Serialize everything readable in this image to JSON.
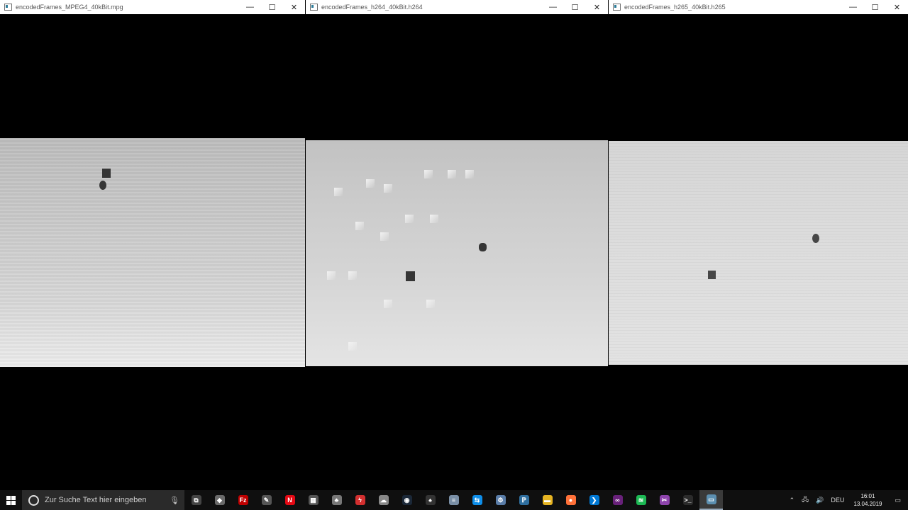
{
  "windows": [
    {
      "title": "encodedFrames_MPEG4_40kBit.mpg"
    },
    {
      "title": "encodedFrames_h264_40kBit.h264"
    },
    {
      "title": "encodedFrames_h265_40kBit.h265"
    }
  ],
  "window_controls": {
    "minimize": "—",
    "maximize": "☐",
    "close": "✕"
  },
  "taskbar": {
    "search_placeholder": "Zur Suche Text hier eingeben",
    "language": "DEU",
    "time": "16:01",
    "date": "13.04.2019",
    "apps": [
      {
        "icon": "task-view-icon",
        "glyph": "⧉",
        "color": "#444444"
      },
      {
        "icon": "git-icon",
        "glyph": "◆",
        "color": "#6a6a6a"
      },
      {
        "icon": "filezilla-icon",
        "glyph": "Fz",
        "color": "#bf0000"
      },
      {
        "icon": "inkscape-icon",
        "glyph": "✎",
        "color": "#555555"
      },
      {
        "icon": "netflix-icon",
        "glyph": "N",
        "color": "#e50914"
      },
      {
        "icon": "calculator-icon",
        "glyph": "▦",
        "color": "#555555"
      },
      {
        "icon": "bird-app-icon",
        "glyph": "♣",
        "color": "#777777"
      },
      {
        "icon": "flash-icon",
        "glyph": "ϟ",
        "color": "#d32f2f"
      },
      {
        "icon": "cloud-app-icon",
        "glyph": "☁",
        "color": "#888888"
      },
      {
        "icon": "steam-icon",
        "glyph": "◉",
        "color": "#1b2838"
      },
      {
        "icon": "cards-icon",
        "glyph": "♠",
        "color": "#333333"
      },
      {
        "icon": "notepad-icon",
        "glyph": "≡",
        "color": "#7a8fa6"
      },
      {
        "icon": "teamviewer-icon",
        "glyph": "⇆",
        "color": "#0e8ee9"
      },
      {
        "icon": "network-app-icon",
        "glyph": "⚙",
        "color": "#5a7da8"
      },
      {
        "icon": "python-icon",
        "glyph": "ℙ",
        "color": "#2f6f9f"
      },
      {
        "icon": "file-explorer-icon",
        "glyph": "▬",
        "color": "#e6b422"
      },
      {
        "icon": "firefox-icon",
        "glyph": "●",
        "color": "#ff7139"
      },
      {
        "icon": "vscode-icon",
        "glyph": "❯",
        "color": "#0078d4"
      },
      {
        "icon": "visual-studio-icon",
        "glyph": "∞",
        "color": "#68217a"
      },
      {
        "icon": "spotify-icon",
        "glyph": "≋",
        "color": "#1db954"
      },
      {
        "icon": "snipping-tool-icon",
        "glyph": "✂",
        "color": "#8e44ad"
      },
      {
        "icon": "terminal-icon",
        "glyph": ">_",
        "color": "#2b2b2b"
      },
      {
        "icon": "active-window-icon",
        "glyph": "▭",
        "color": "#5c8fb0"
      }
    ]
  }
}
